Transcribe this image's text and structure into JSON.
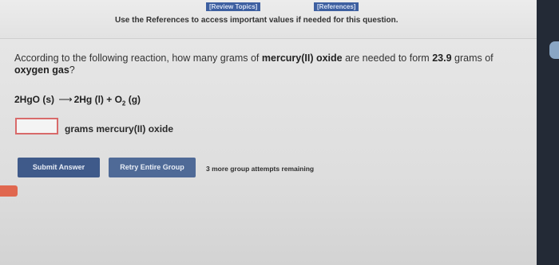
{
  "header": {
    "review_topics": "[Review Topics]",
    "references": "[References]",
    "notice": "Use the References to access important values if needed for this question."
  },
  "question": {
    "part1": "According to the following reaction, how many grams of ",
    "compound": "mercury(II) oxide",
    "part2": " are needed to form ",
    "amount": "23.9",
    "part3": " grams of ",
    "gas": "oxygen gas",
    "part4": "?"
  },
  "equation": {
    "reactant": "2HgO (s)",
    "arrow": "⟶",
    "product1": "2Hg (l) + O",
    "subscript": "2",
    "product2": " (g)"
  },
  "answer": {
    "value": "",
    "unit_label": "grams mercury(II) oxide"
  },
  "buttons": {
    "submit": "Submit Answer",
    "retry": "Retry Entire Group"
  },
  "status": {
    "remaining": "3 more group attempts remaining"
  },
  "colors": {
    "button_blue": "#3f5a8a",
    "input_border": "#d86a6a",
    "side_tab": "#e0674f"
  }
}
